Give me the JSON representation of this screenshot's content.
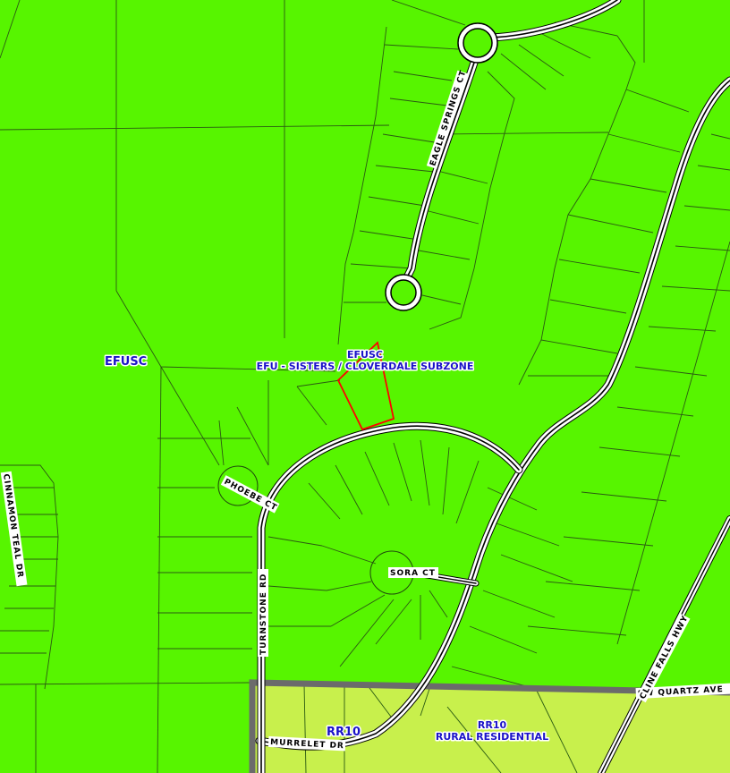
{
  "zones": {
    "efusc_west": {
      "code": "EFUSC"
    },
    "efusc_center": {
      "code": "EFUSC",
      "name": "EFU - SISTERS / CLOVERDALE SUBZONE"
    },
    "rr10_left": {
      "code": "RR10"
    },
    "rr10_right": {
      "code": "RR10",
      "name": "RURAL RESIDENTIAL"
    }
  },
  "streets": {
    "eagle_springs": "EAGLE SPRINGS CT",
    "phoebe": "PHOEBE CT",
    "sora": "SORA CT",
    "turnstone": "TURNSTONE RD",
    "murrelet": "MURRELET DR",
    "cinnamon_teal": "CINNAMON TEAL DR",
    "quartz": "SW QUARTZ AVE",
    "cline_falls": "CLINE FALLS HWY"
  },
  "colors": {
    "efu_zone": "#57f500",
    "rr10_zone": "#c8f04c",
    "zone_boundary": "#6b6b6b",
    "parcel_line": "#2b5a12",
    "selected_parcel": "#ff0000",
    "label_text": "#1a12c8"
  }
}
